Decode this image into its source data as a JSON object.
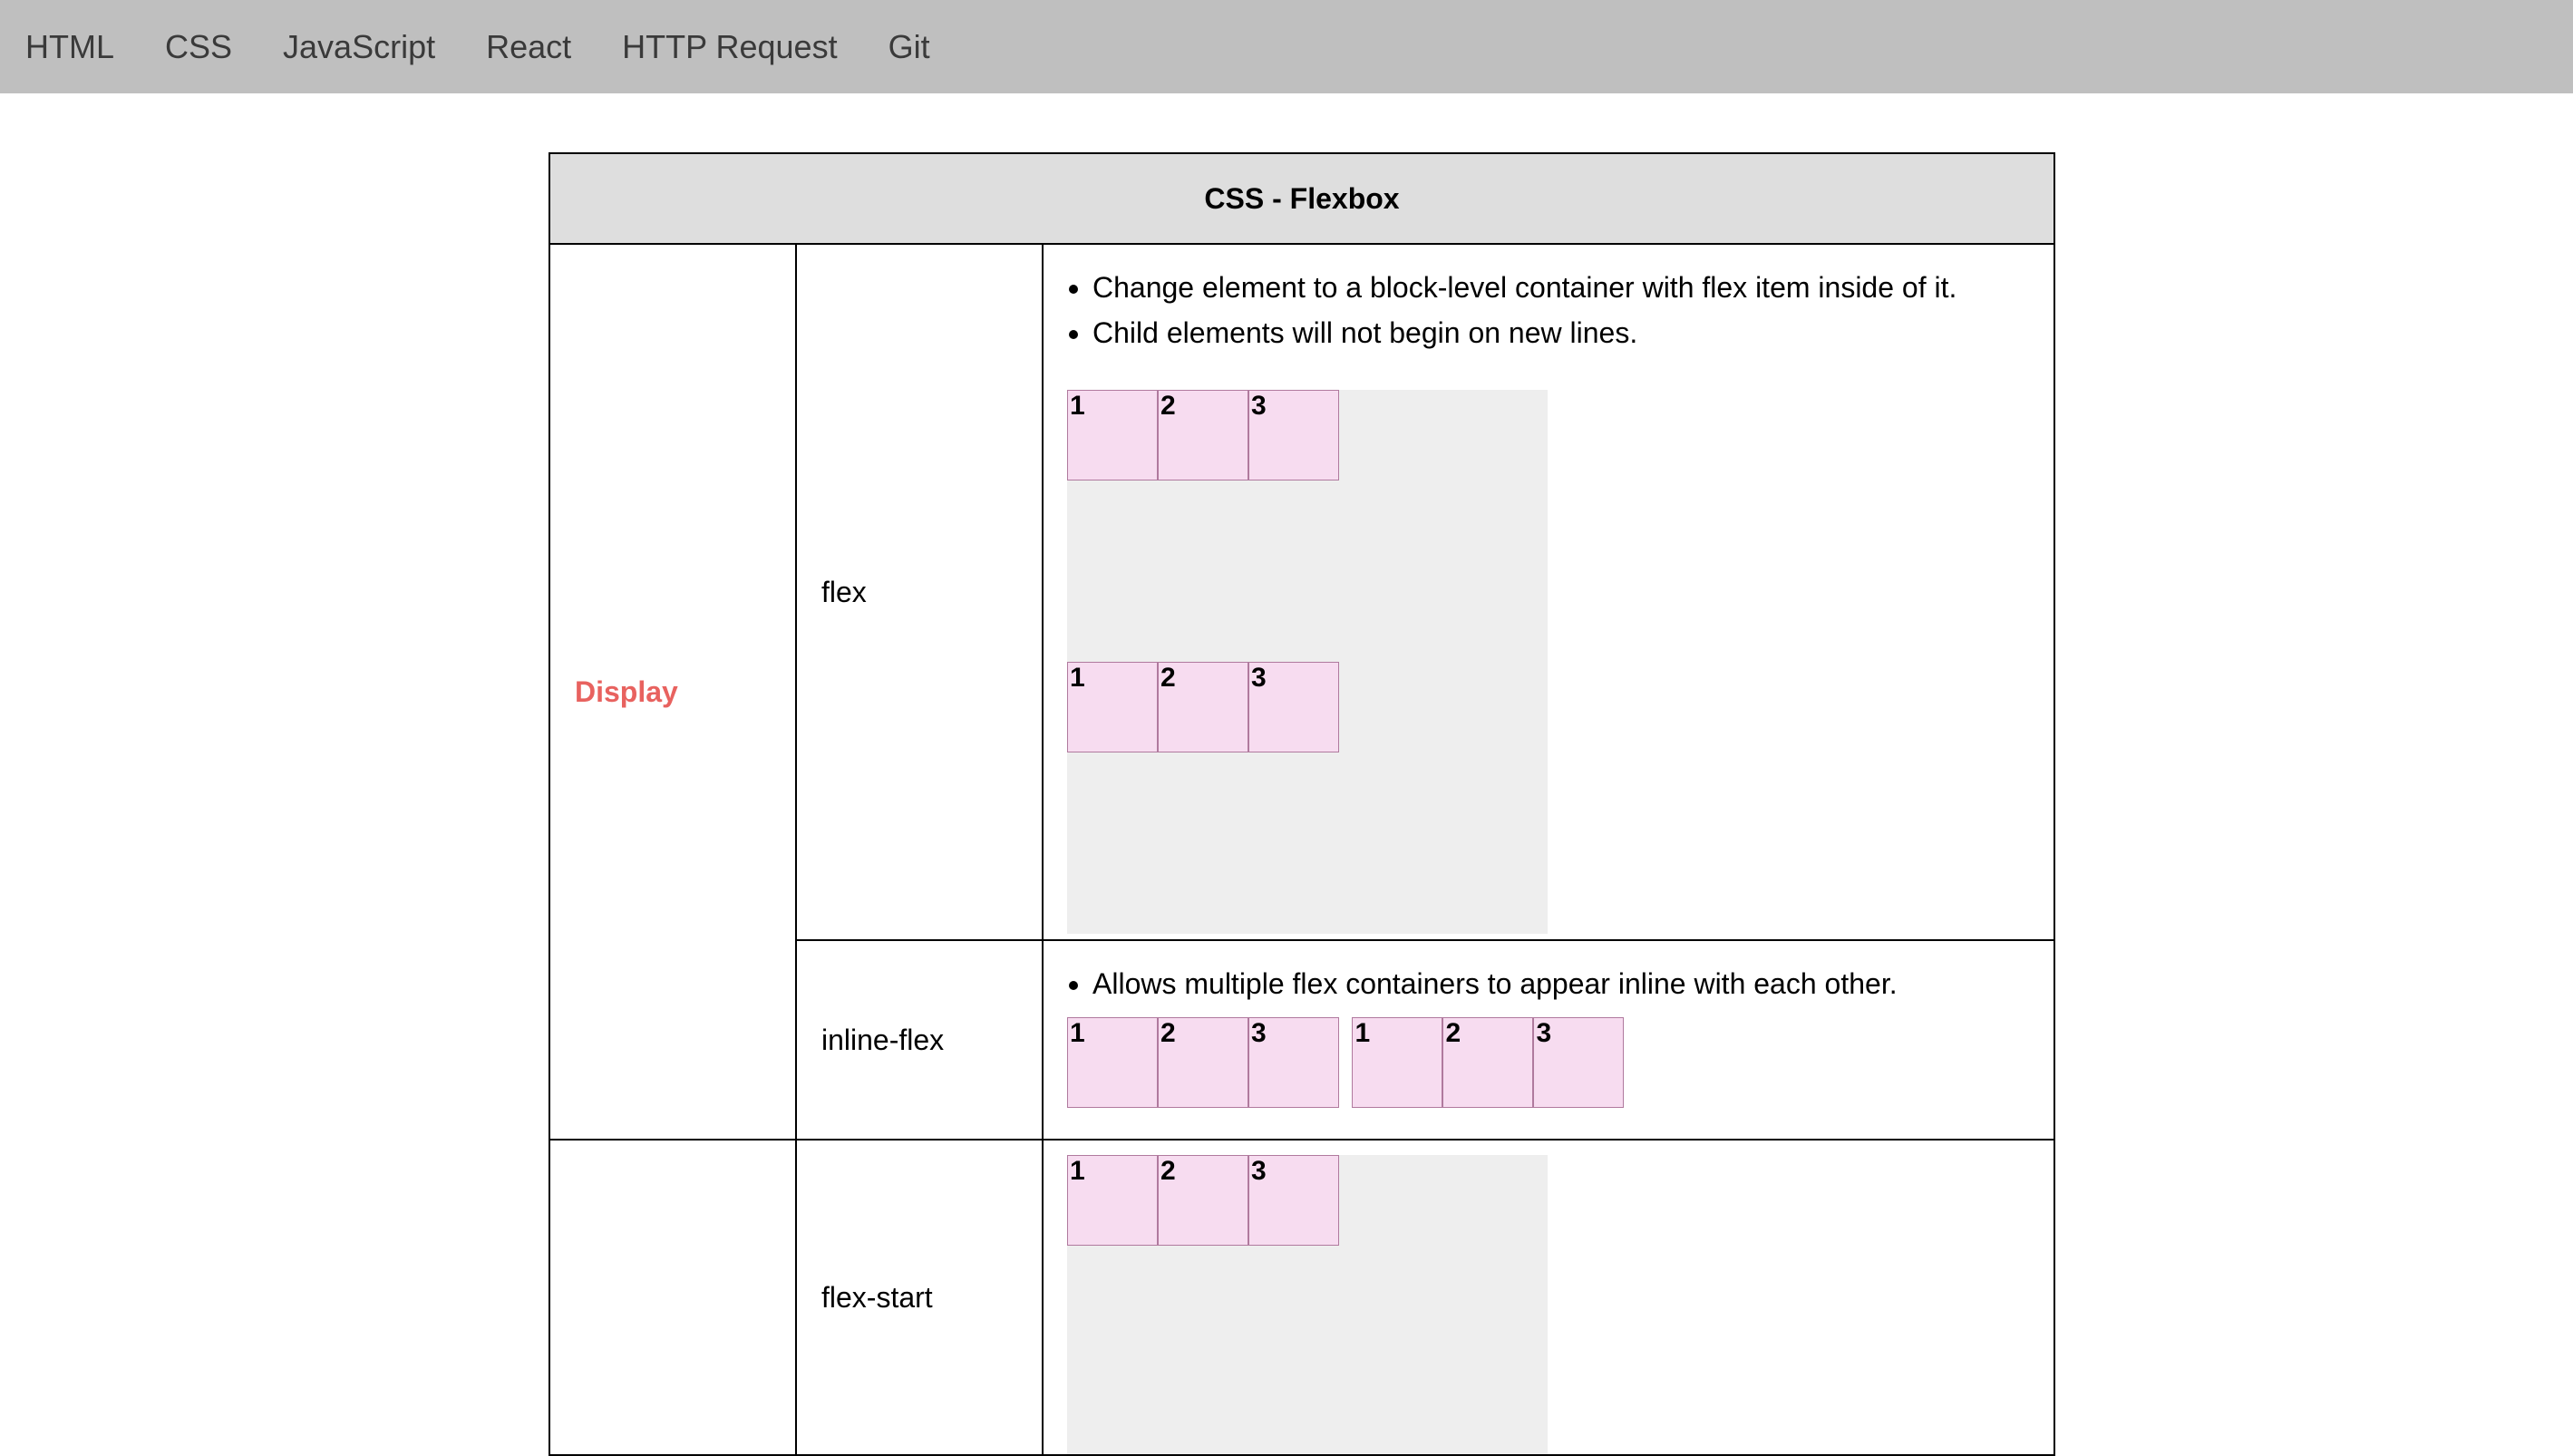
{
  "nav": {
    "items": [
      {
        "label": "HTML"
      },
      {
        "label": "CSS"
      },
      {
        "label": "JavaScript"
      },
      {
        "label": "React"
      },
      {
        "label": "HTTP Request"
      },
      {
        "label": "Git"
      }
    ]
  },
  "table": {
    "title": "CSS - Flexbox",
    "rows": {
      "display": {
        "category": "Display",
        "flex": {
          "value": "flex",
          "bullets": [
            "Change element to a block-level container with flex item inside of it.",
            "Child elements will not begin on new lines."
          ],
          "boxes_a": [
            "1",
            "2",
            "3"
          ],
          "boxes_b": [
            "1",
            "2",
            "3"
          ]
        },
        "inline_flex": {
          "value": "inline-flex",
          "bullets": [
            "Allows multiple flex containers to appear inline with each other."
          ],
          "boxes_a": [
            "1",
            "2",
            "3"
          ],
          "boxes_b": [
            "1",
            "2",
            "3"
          ]
        }
      },
      "justify": {
        "flex_start": {
          "value": "flex-start",
          "boxes": [
            "1",
            "2",
            "3"
          ]
        }
      }
    }
  },
  "colors": {
    "navbar_bg": "#bfbfbf",
    "header_bg": "#dedede",
    "category_accent": "#e8625f",
    "box_fill": "#f7dcf0",
    "demo_bg": "#eeeeee"
  }
}
